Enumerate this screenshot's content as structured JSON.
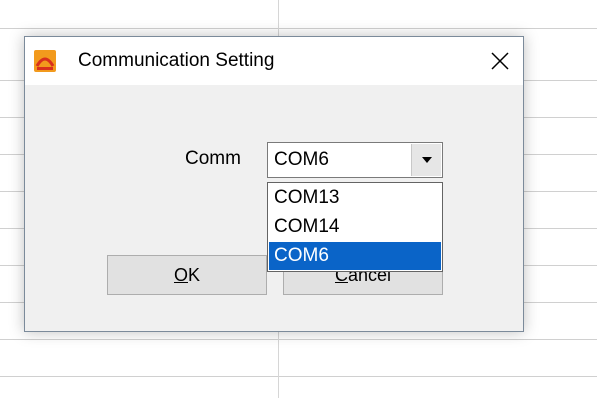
{
  "dialog": {
    "title": "Communication Setting",
    "app_icon": "app-logo-icon",
    "close_icon": "close-icon"
  },
  "comm": {
    "label": "Comm",
    "selected_value": "COM6",
    "dropdown_icon": "chevron-down-icon",
    "options": [
      "COM13",
      "COM14",
      "COM6"
    ],
    "highlighted_option": "COM6"
  },
  "buttons": {
    "ok_mnemonic": "O",
    "ok_rest": "K",
    "cancel_mnemonic": "C",
    "cancel_rest": "ancel"
  },
  "colors": {
    "selection": "#0a64c8",
    "dialog_bg": "#f0f0f0",
    "icon_orange": "#f29a1d",
    "icon_red": "#d9301c"
  }
}
